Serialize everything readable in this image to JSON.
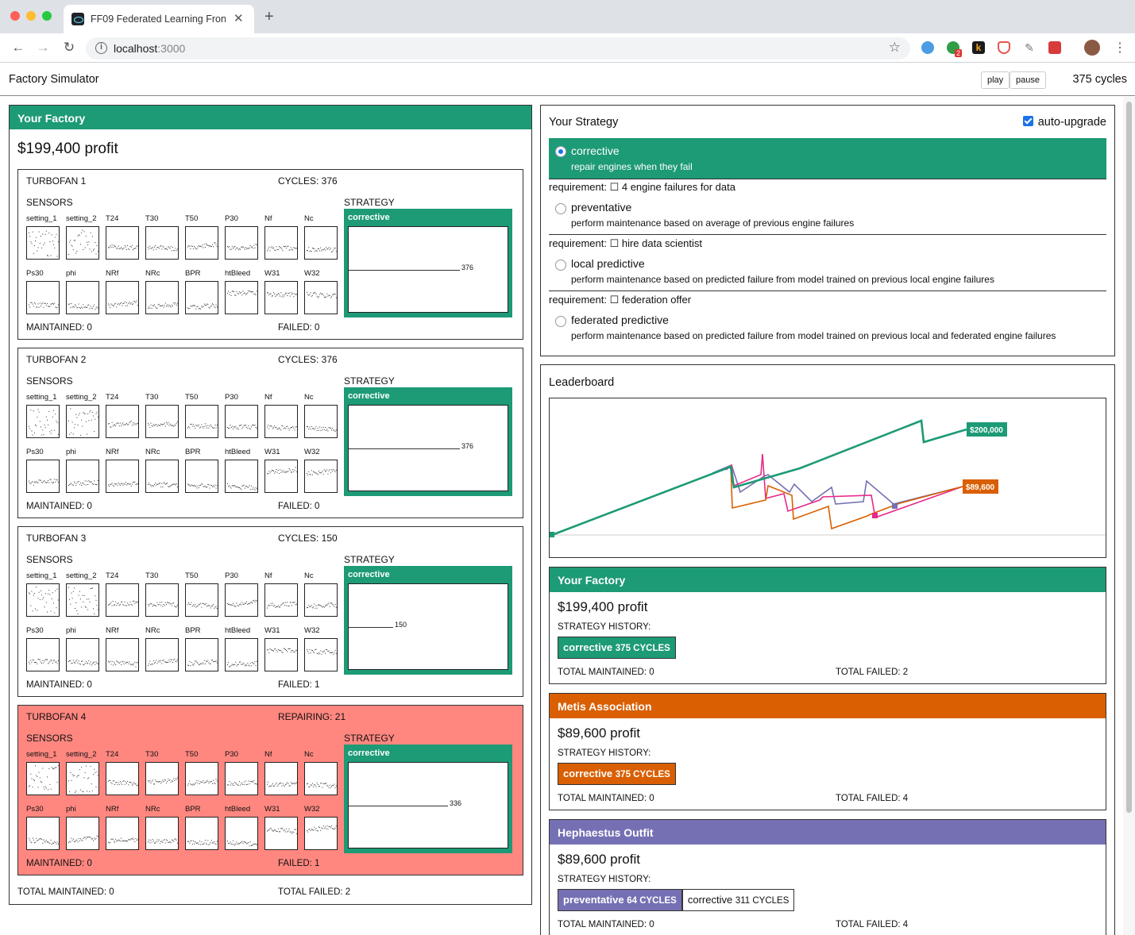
{
  "browser": {
    "tab_title": "FF09 Federated Learning Front",
    "tab_close": "✕",
    "new_tab": "+",
    "url_host": "localhost",
    "url_port": ":3000",
    "ext_badge": "2",
    "ext_k": "k"
  },
  "header": {
    "title": "Factory Simulator",
    "play_label": "play",
    "pause_label": "pause",
    "cycles": "375 cycles"
  },
  "factory": {
    "title": "Your Factory",
    "profit": "$199,400 profit",
    "sensors_label": "SENSORS",
    "strategy_label": "STRATEGY",
    "total_maintained": "TOTAL MAINTAINED: 0",
    "total_failed": "TOTAL FAILED: 2",
    "sensor_names": [
      "setting_1",
      "setting_2",
      "T24",
      "T30",
      "T50",
      "P30",
      "Nf",
      "Nc",
      "Ps30",
      "phi",
      "NRf",
      "NRc",
      "BPR",
      "htBleed",
      "W31",
      "W32"
    ],
    "engines": [
      {
        "name": "TURBOFAN 1",
        "status": "CYCLES: 376",
        "strategy": "corrective",
        "value": "376",
        "maintained": "MAINTAINED: 0",
        "failed": "FAILED: 0",
        "repairing": false
      },
      {
        "name": "TURBOFAN 2",
        "status": "CYCLES: 376",
        "strategy": "corrective",
        "value": "376",
        "maintained": "MAINTAINED: 0",
        "failed": "FAILED: 0",
        "repairing": false
      },
      {
        "name": "TURBOFAN 3",
        "status": "CYCLES: 150",
        "strategy": "corrective",
        "value": "150",
        "maintained": "MAINTAINED: 0",
        "failed": "FAILED: 1",
        "repairing": false
      },
      {
        "name": "TURBOFAN 4",
        "status": "REPAIRING: 21",
        "strategy": "corrective",
        "value": "336",
        "maintained": "MAINTAINED: 0",
        "failed": "FAILED: 1",
        "repairing": true
      }
    ]
  },
  "strategy": {
    "title": "Your Strategy",
    "auto_upgrade": "auto-upgrade",
    "options": [
      {
        "title": "corrective",
        "desc": "repair engines when they fail",
        "requirement": ""
      },
      {
        "title": "preventative",
        "desc": "perform maintenance based on average of previous engine failures",
        "requirement": "requirement: ☐ 4 engine failures for data"
      },
      {
        "title": "local predictive",
        "desc": "perform maintenance based on predicted failure from model trained on previous local engine failures",
        "requirement": "requirement: ☐ hire data scientist"
      },
      {
        "title": "federated predictive",
        "desc": "perform maintenance based on predicted failure from model trained on previous local and federated engine failures",
        "requirement": "requirement: ☐ federation offer"
      }
    ]
  },
  "leaderboard": {
    "title": "Leaderboard",
    "chart_labels": {
      "top": "$200,000",
      "bottom": "$89,600"
    },
    "teams": [
      {
        "name": "Your Factory",
        "color": "#1d9a76",
        "profit": "$199,400 profit",
        "history_label": "STRATEGY HISTORY:",
        "history": [
          {
            "strategy": "corrective",
            "cycles": "375 CYCLES"
          }
        ],
        "maintained": "TOTAL MAINTAINED: 0",
        "failed": "TOTAL FAILED: 2"
      },
      {
        "name": "Metis Association",
        "color": "#d95f02",
        "profit": "$89,600 profit",
        "history_label": "STRATEGY HISTORY:",
        "history": [
          {
            "strategy": "corrective",
            "cycles": "375 CYCLES"
          }
        ],
        "maintained": "TOTAL MAINTAINED: 0",
        "failed": "TOTAL FAILED: 4"
      },
      {
        "name": "Hephaestus Outfit",
        "color": "#7570b3",
        "profit": "$89,600 profit",
        "history_label": "STRATEGY HISTORY:",
        "history": [
          {
            "strategy": "preventative",
            "cycles": "64 CYCLES"
          },
          {
            "strategy": "corrective",
            "cycles": "311 CYCLES"
          }
        ],
        "maintained": "TOTAL MAINTAINED: 0",
        "failed": "TOTAL FAILED: 4"
      }
    ]
  },
  "colors": {
    "green": "#1d9a76",
    "orange": "#d95f02",
    "purple": "#7570b3",
    "pink": "#e7298a",
    "repair_bg": "#ff8780"
  }
}
